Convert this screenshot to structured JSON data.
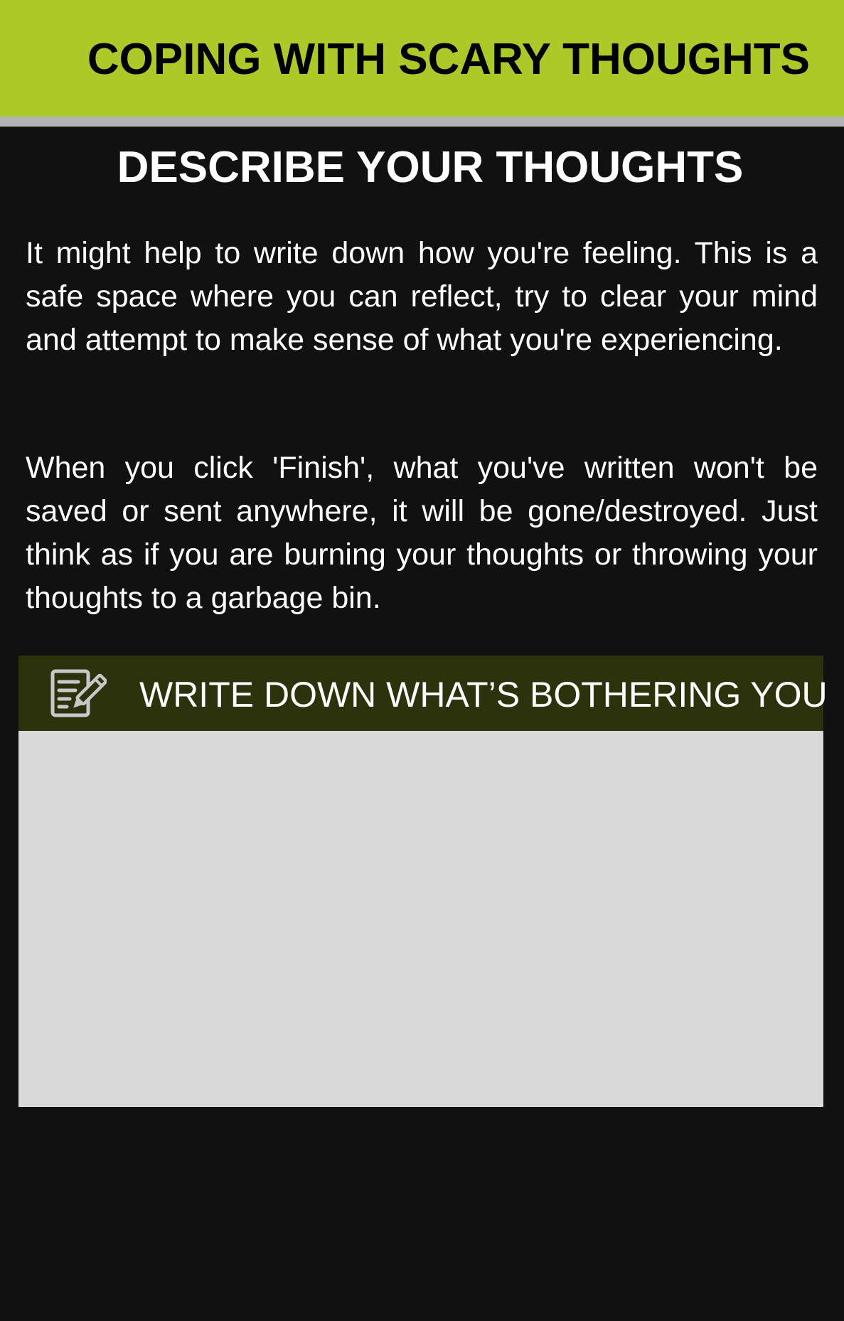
{
  "app": {
    "header_title": "COPING WITH SCARY THOUGHTS"
  },
  "main": {
    "section_title": "DESCRIBE YOUR THOUGHTS",
    "paragraph_1": "It might help to write down how you're feeling. This is a safe space where you can reflect, try to clear your mind and attempt to make sense of what you're experiencing.",
    "paragraph_2": "When you click 'Finish', what you've written won't be saved or sent anywhere, it will be gone/destroyed. Just think as if you are burning your thoughts or throwing your thoughts to a garbage bin."
  },
  "write_panel": {
    "icon": "note-edit-icon",
    "label": "WRITE DOWN WHAT’S BOTHERING YOU",
    "value": "",
    "placeholder": ""
  },
  "colors": {
    "header_accent": "#abc928",
    "divider": "#b3b3b3",
    "background": "#111111",
    "panel_header": "#2c320c",
    "write_area": "#d9d9d9"
  }
}
